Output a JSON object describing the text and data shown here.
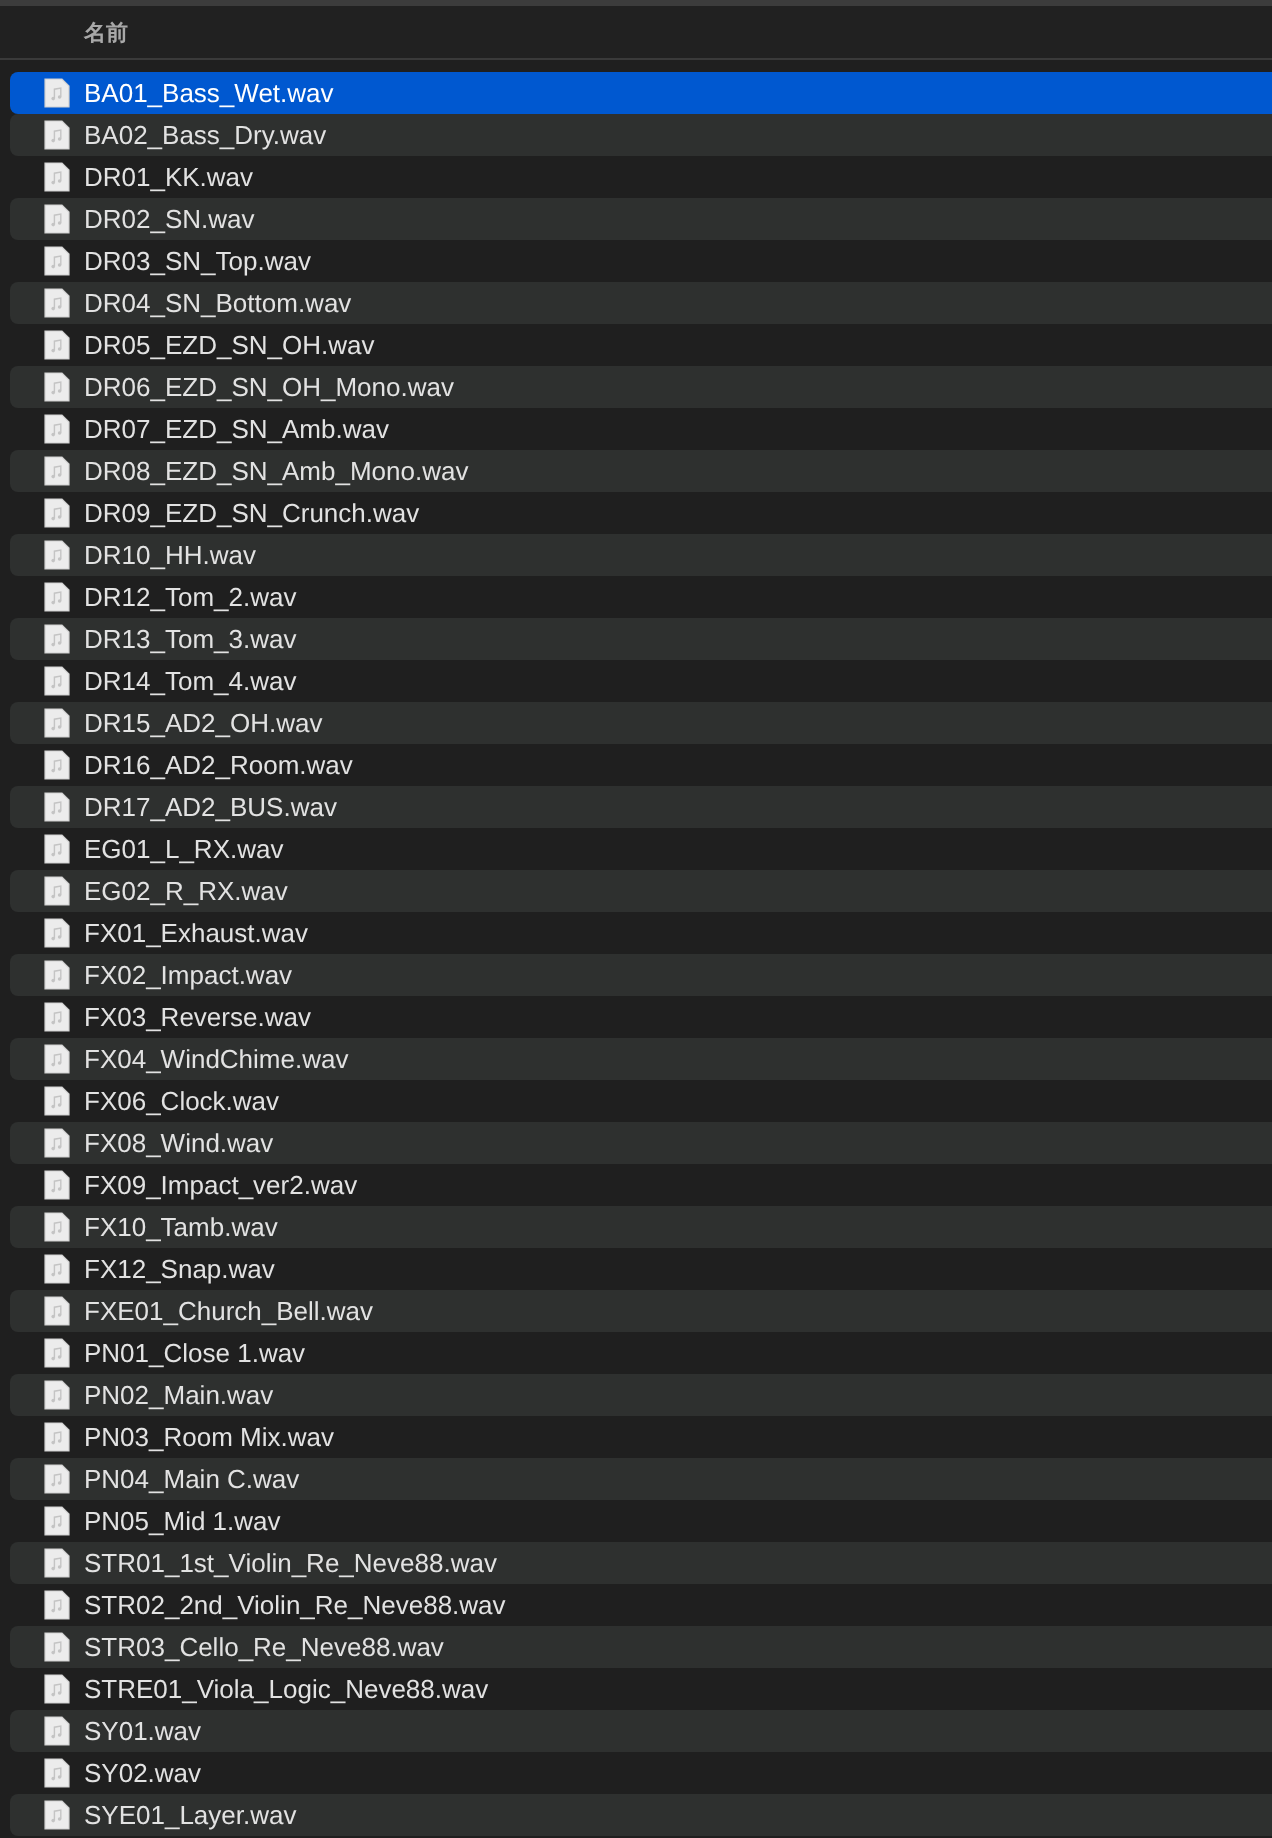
{
  "columns": [
    {
      "label": "名前"
    }
  ],
  "files": [
    {
      "name": "BA01_Bass_Wet.wav",
      "selected": true
    },
    {
      "name": "BA02_Bass_Dry.wav",
      "selected": false
    },
    {
      "name": "DR01_KK.wav",
      "selected": false
    },
    {
      "name": "DR02_SN.wav",
      "selected": false
    },
    {
      "name": "DR03_SN_Top.wav",
      "selected": false
    },
    {
      "name": "DR04_SN_Bottom.wav",
      "selected": false
    },
    {
      "name": "DR05_EZD_SN_OH.wav",
      "selected": false
    },
    {
      "name": "DR06_EZD_SN_OH_Mono.wav",
      "selected": false
    },
    {
      "name": "DR07_EZD_SN_Amb.wav",
      "selected": false
    },
    {
      "name": "DR08_EZD_SN_Amb_Mono.wav",
      "selected": false
    },
    {
      "name": "DR09_EZD_SN_Crunch.wav",
      "selected": false
    },
    {
      "name": "DR10_HH.wav",
      "selected": false
    },
    {
      "name": "DR12_Tom_2.wav",
      "selected": false
    },
    {
      "name": "DR13_Tom_3.wav",
      "selected": false
    },
    {
      "name": "DR14_Tom_4.wav",
      "selected": false
    },
    {
      "name": "DR15_AD2_OH.wav",
      "selected": false
    },
    {
      "name": "DR16_AD2_Room.wav",
      "selected": false
    },
    {
      "name": "DR17_AD2_BUS.wav",
      "selected": false
    },
    {
      "name": "EG01_L_RX.wav",
      "selected": false
    },
    {
      "name": "EG02_R_RX.wav",
      "selected": false
    },
    {
      "name": "FX01_Exhaust.wav",
      "selected": false
    },
    {
      "name": "FX02_Impact.wav",
      "selected": false
    },
    {
      "name": "FX03_Reverse.wav",
      "selected": false
    },
    {
      "name": "FX04_WindChime.wav",
      "selected": false
    },
    {
      "name": "FX06_Clock.wav",
      "selected": false
    },
    {
      "name": "FX08_Wind.wav",
      "selected": false
    },
    {
      "name": "FX09_Impact_ver2.wav",
      "selected": false
    },
    {
      "name": "FX10_Tamb.wav",
      "selected": false
    },
    {
      "name": "FX12_Snap.wav",
      "selected": false
    },
    {
      "name": "FXE01_Church_Bell.wav",
      "selected": false
    },
    {
      "name": "PN01_Close 1.wav",
      "selected": false
    },
    {
      "name": "PN02_Main.wav",
      "selected": false
    },
    {
      "name": "PN03_Room Mix.wav",
      "selected": false
    },
    {
      "name": "PN04_Main C.wav",
      "selected": false
    },
    {
      "name": "PN05_Mid 1.wav",
      "selected": false
    },
    {
      "name": "STR01_1st_Violin_Re_Neve88.wav",
      "selected": false
    },
    {
      "name": "STR02_2nd_Violin_Re_Neve88.wav",
      "selected": false
    },
    {
      "name": "STR03_Cello_Re_Neve88.wav",
      "selected": false
    },
    {
      "name": "STRE01_Viola_Logic_Neve88.wav",
      "selected": false
    },
    {
      "name": "SY01.wav",
      "selected": false
    },
    {
      "name": "SY02.wav",
      "selected": false
    },
    {
      "name": "SYE01_Layer.wav",
      "selected": false
    }
  ]
}
